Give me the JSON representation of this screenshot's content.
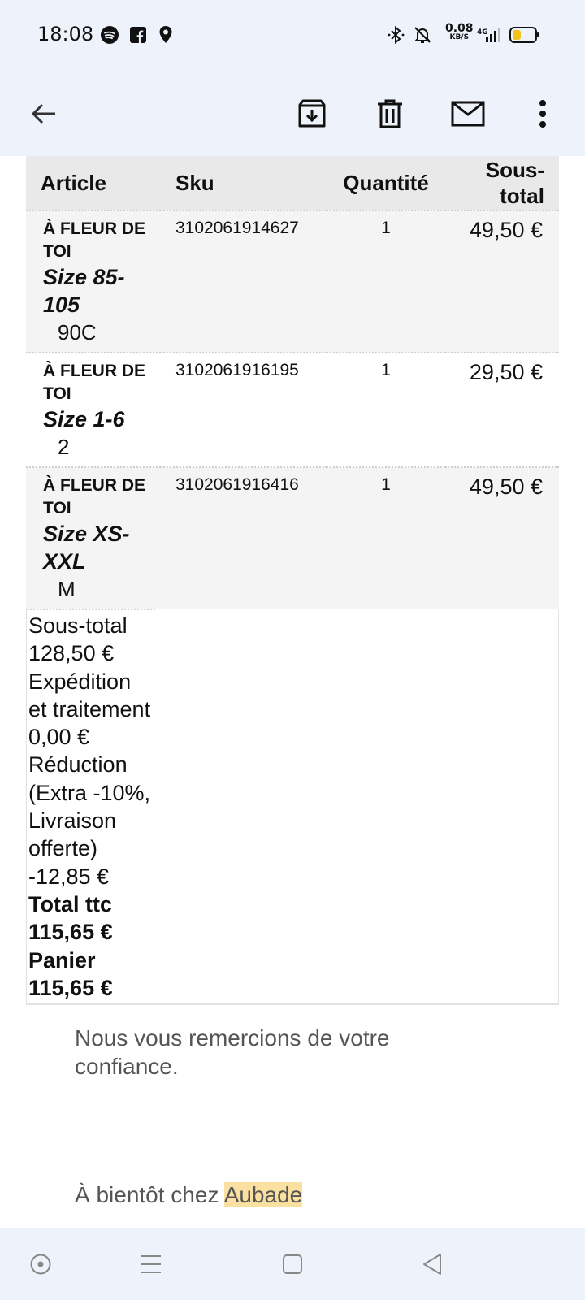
{
  "status_bar": {
    "time": "18:08",
    "net_speed": "0.08",
    "net_unit": "KB/S",
    "network": "4G",
    "battery_color": "#f2c21b"
  },
  "app_bar": {
    "back_icon": "arrow-left-icon",
    "actions": [
      "archive-icon",
      "trash-icon",
      "mail-icon",
      "more-vert-icon"
    ]
  },
  "table": {
    "headers": {
      "article": "Article",
      "sku": "Sku",
      "quantity": "Quantité",
      "subtotal_line1": "Sous-",
      "subtotal_line2": "total"
    },
    "items": [
      {
        "brand": "À FLEUR DE TOI",
        "option_label": "Size 85-105",
        "option_value": "90C",
        "sku": "3102061914627",
        "qty": "1",
        "subtotal": "49,50 €"
      },
      {
        "brand": "À FLEUR DE TOI",
        "option_label": "Size 1-6",
        "option_value": "2",
        "sku": "3102061916195",
        "qty": "1",
        "subtotal": "29,50 €"
      },
      {
        "brand": "À FLEUR DE TOI",
        "option_label": "Size XS-XXL",
        "option_value": "M",
        "sku": "3102061916416",
        "qty": "1",
        "subtotal": "49,50 €"
      }
    ]
  },
  "totals": {
    "subtotal_label": "Sous-total",
    "subtotal_value": "128,50 €",
    "shipping_label": "Expédition et traitement",
    "shipping_value": "0,00 €",
    "discount_label": "Réduction (Extra -10%, Livraison offerte)",
    "discount_value": "-12,85 €",
    "total_label": "Total ttc",
    "total_value": "115,65 €",
    "cart_label": "Panier",
    "cart_value": "115,65 €"
  },
  "footer": {
    "thanks": "Nous vous remercions de votre confiance.",
    "bye_prefix": "À bientôt chez ",
    "bye_brand": "Aubade"
  }
}
